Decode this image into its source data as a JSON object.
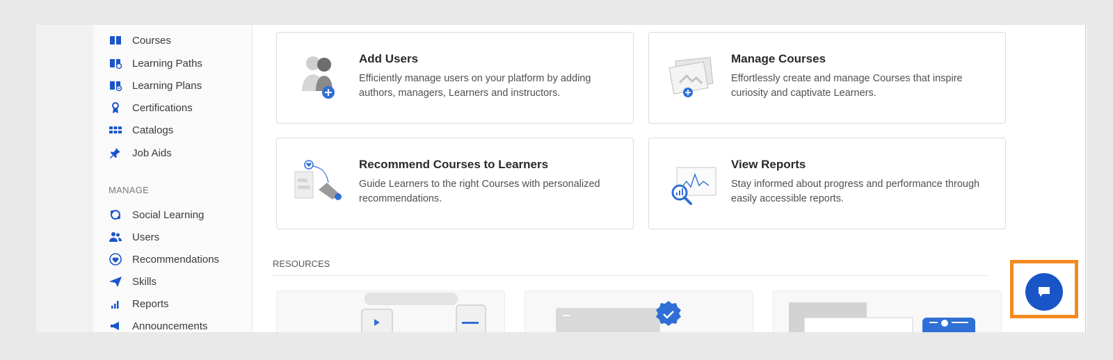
{
  "sidebar": {
    "browse_items": [
      {
        "label": "Courses",
        "icon": "book-icon"
      },
      {
        "label": "Learning Paths",
        "icon": "learning-path-icon"
      },
      {
        "label": "Learning Plans",
        "icon": "learning-plan-icon"
      },
      {
        "label": "Certifications",
        "icon": "certificate-icon"
      },
      {
        "label": "Catalogs",
        "icon": "grid-icon"
      },
      {
        "label": "Job Aids",
        "icon": "pin-icon"
      }
    ],
    "manage_label": "MANAGE",
    "manage_items": [
      {
        "label": "Social Learning",
        "icon": "social-icon"
      },
      {
        "label": "Users",
        "icon": "users-icon"
      },
      {
        "label": "Recommendations",
        "icon": "heart-icon"
      },
      {
        "label": "Skills",
        "icon": "paper-plane-icon"
      },
      {
        "label": "Reports",
        "icon": "bar-chart-icon"
      },
      {
        "label": "Announcements",
        "icon": "megaphone-icon"
      }
    ]
  },
  "cards": [
    {
      "title": "Add Users",
      "desc": "Efficiently manage users on your platform by adding authors, managers, Learners and instructors."
    },
    {
      "title": "Manage Courses",
      "desc": "Effortlessly create and manage Courses that inspire curiosity and captivate Learners."
    },
    {
      "title": "Recommend Courses to Learners",
      "desc": "Guide Learners to the right Courses with personalized recommendations."
    },
    {
      "title": "View Reports",
      "desc": "Stay informed about progress and performance through easily accessible reports."
    }
  ],
  "resources": {
    "label": "RESOURCES"
  },
  "colors": {
    "accent": "#1a55c8",
    "highlight": "#f4891f",
    "icon_blue": "#2f6fd6"
  },
  "chat": {
    "icon": "chat-bubble-icon"
  }
}
